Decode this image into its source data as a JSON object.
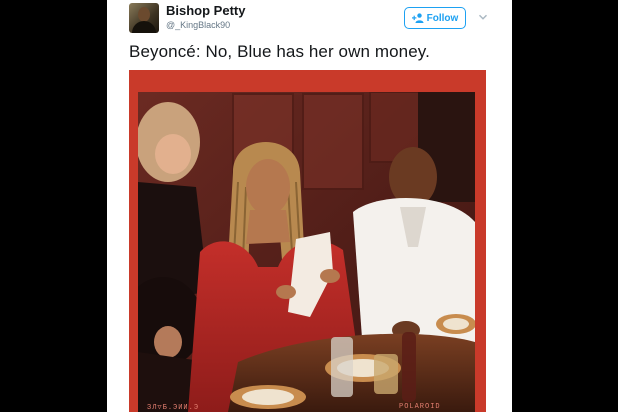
{
  "tweet": {
    "display_name": "Bishop Petty",
    "handle": "@_KingBlack90",
    "follow_label": "Follow",
    "text": "Beyoncé: No, Blue has her own money."
  },
  "photo": {
    "strip_text": "ЗЛ▽Б.ЭИИ.Э",
    "strip_brand": "POLAROID"
  },
  "colors": {
    "accent": "#1da1f2",
    "frame": "#c93a2a"
  },
  "icons": {
    "follow": "add-user-icon",
    "menu": "chevron-down-icon"
  }
}
